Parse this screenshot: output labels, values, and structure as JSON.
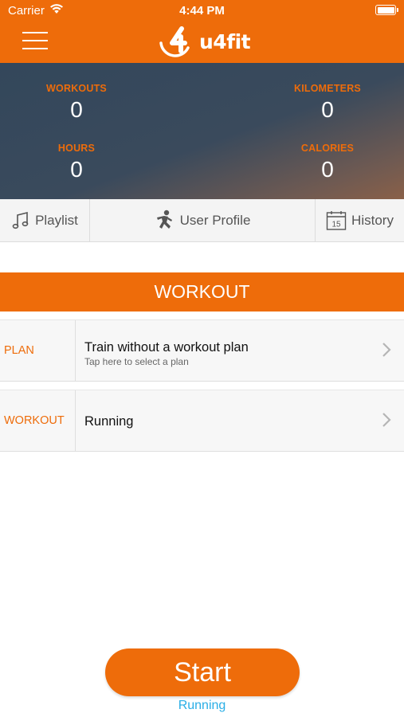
{
  "status_bar": {
    "carrier": "Carrier",
    "time": "4:44 PM"
  },
  "header": {
    "logo_text": "u4fit",
    "brand_color": "#ee6c0a"
  },
  "stats": {
    "workouts": {
      "label": "WORKOUTS",
      "value": "0"
    },
    "kilometers": {
      "label": "KILOMETERS",
      "value": "0"
    },
    "hours": {
      "label": "HOURS",
      "value": "0"
    },
    "calories": {
      "label": "CALORIES",
      "value": "0"
    }
  },
  "tabs": {
    "playlist": {
      "label": "Playlist",
      "icon": "music-note-icon"
    },
    "user_profile": {
      "label": "User Profile",
      "icon": "runner-icon"
    },
    "history": {
      "label": "History",
      "icon": "calendar-icon",
      "calendar_day": "15"
    }
  },
  "section": {
    "title": "WORKOUT"
  },
  "rows": {
    "plan": {
      "label": "PLAN",
      "title": "Train without a workout plan",
      "subtitle": "Tap here to select a plan"
    },
    "workout": {
      "label": "WORKOUT",
      "title": "Running"
    }
  },
  "start": {
    "label": "Start",
    "subtitle": "Running",
    "subtitle_color": "#29aee6"
  }
}
